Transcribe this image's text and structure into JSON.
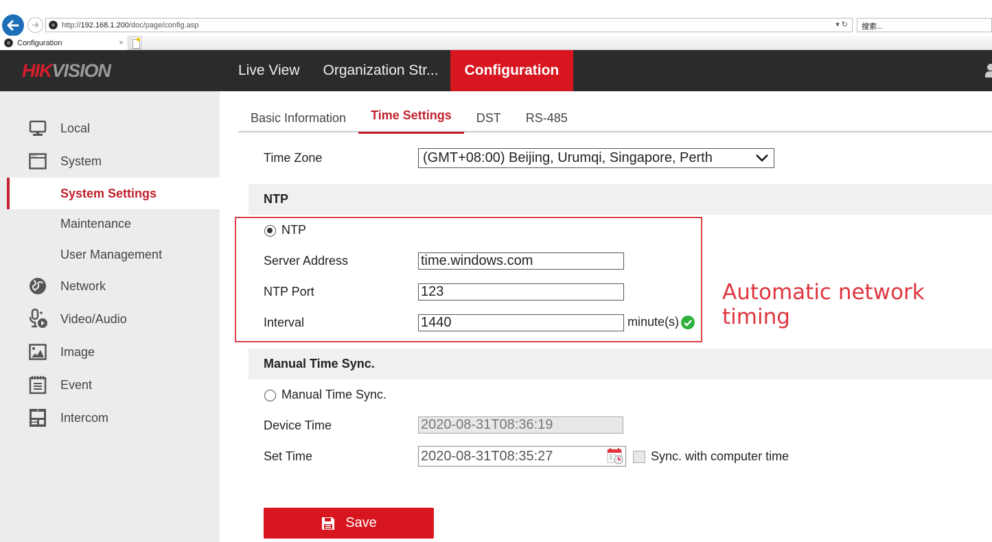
{
  "browser": {
    "url_prefix": "http://",
    "url_host": "192.168.1.200",
    "url_path": "/doc/page/config.asp",
    "address_tools": "▾ ↻",
    "search_placeholder": "搜索...",
    "tab_title": "Configuration",
    "tab_close": "×"
  },
  "header": {
    "logo_part1": "HIK",
    "logo_part2": "VISION",
    "nav": [
      {
        "label": "Live View"
      },
      {
        "label": "Organization Str..."
      },
      {
        "label": "Configuration",
        "active": true
      }
    ]
  },
  "sidebar": {
    "items": [
      {
        "label": "Local",
        "icon": "monitor-icon"
      },
      {
        "label": "System",
        "icon": "window-icon"
      },
      {
        "label": "System Settings",
        "active": true
      },
      {
        "label": "Maintenance"
      },
      {
        "label": "User Management"
      },
      {
        "label": "Network",
        "icon": "globe-icon"
      },
      {
        "label": "Video/Audio",
        "icon": "mic-play-icon"
      },
      {
        "label": "Image",
        "icon": "image-icon"
      },
      {
        "label": "Event",
        "icon": "notepad-icon"
      },
      {
        "label": "Intercom",
        "icon": "intercom-icon"
      }
    ]
  },
  "tabs": [
    {
      "label": "Basic Information"
    },
    {
      "label": "Time Settings",
      "active": true
    },
    {
      "label": "DST"
    },
    {
      "label": "RS-485"
    }
  ],
  "form": {
    "time_zone_label": "Time Zone",
    "time_zone_value": "(GMT+08:00) Beijing, Urumqi, Singapore, Perth",
    "ntp_section_title": "NTP",
    "ntp_radio_label": "NTP",
    "ntp_radio_checked": true,
    "server_address_label": "Server Address",
    "server_address_value": "time.windows.com",
    "ntp_port_label": "NTP Port",
    "ntp_port_value": "123",
    "interval_label": "Interval",
    "interval_value": "1440",
    "interval_unit": "minute(s)",
    "manual_section_title": "Manual Time Sync.",
    "manual_radio_label": "Manual Time Sync.",
    "manual_radio_checked": false,
    "device_time_label": "Device Time",
    "device_time_value": "2020-08-31T08:36:19",
    "set_time_label": "Set Time",
    "set_time_value": "2020-08-31T08:35:27",
    "sync_checkbox_label": "Sync. with computer time",
    "sync_checkbox_checked": false,
    "save_label": "Save"
  },
  "annotation": {
    "text": "Automatic network timing",
    "color": "#e0343e"
  },
  "colors": {
    "accent": "#d7161f",
    "header_bg": "#2b2b2b",
    "sidebar_bg": "#ececec",
    "ok_green": "#2eb03c"
  }
}
